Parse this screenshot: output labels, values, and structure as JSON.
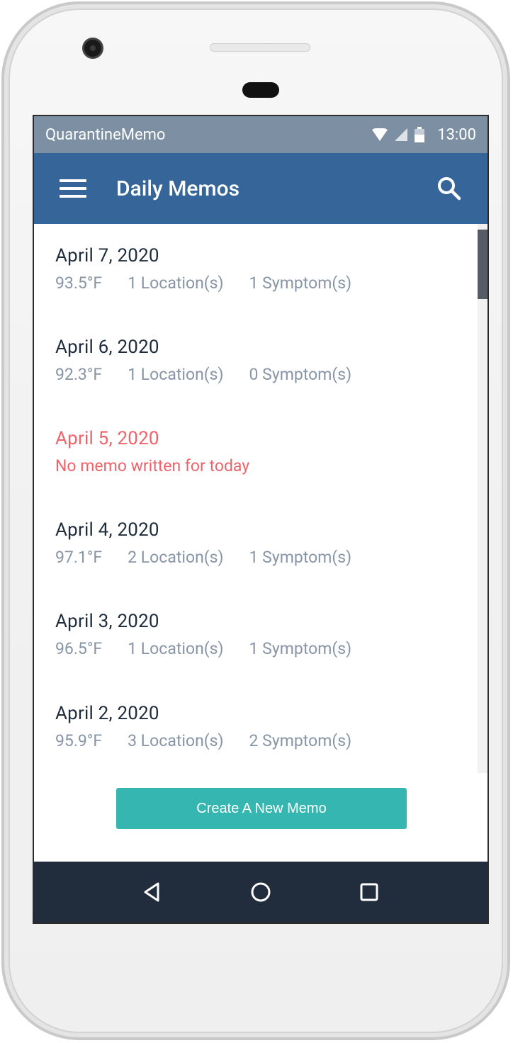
{
  "status_bar": {
    "app_name": "QuarantineMemo",
    "time": "13:00"
  },
  "app_bar": {
    "title": "Daily Memos"
  },
  "memos": [
    {
      "date": "April 7, 2020",
      "temperature": "93.5°F",
      "locations": "1 Location(s)",
      "symptoms": "1 Symptom(s)"
    },
    {
      "date": "April 6, 2020",
      "temperature": "92.3°F",
      "locations": "1 Location(s)",
      "symptoms": "0 Symptom(s)"
    },
    {
      "date": "April 5, 2020",
      "missing_text": "No memo written for today"
    },
    {
      "date": "April 4, 2020",
      "temperature": "97.1°F",
      "locations": "2 Location(s)",
      "symptoms": "1 Symptom(s)"
    },
    {
      "date": "April 3, 2020",
      "temperature": "96.5°F",
      "locations": "1 Location(s)",
      "symptoms": "1 Symptom(s)"
    },
    {
      "date": "April 2, 2020",
      "temperature": "95.9°F",
      "locations": "3 Location(s)",
      "symptoms": "2 Symptom(s)"
    }
  ],
  "create_button": {
    "label": "Create A New Memo"
  },
  "colors": {
    "app_bar": "#356599",
    "status_bar": "#7c8fa3",
    "accent": "#36b6b0",
    "missing": "#f0626a",
    "nav_bar": "#212c3d"
  }
}
